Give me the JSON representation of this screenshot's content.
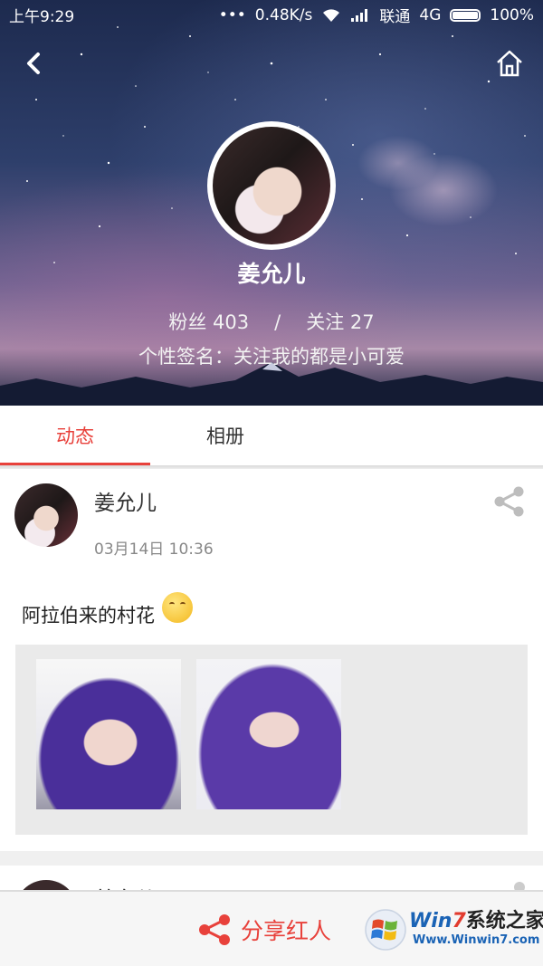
{
  "status_bar": {
    "time": "上午9:29",
    "network_speed": "0.48K/s",
    "carrier": "联通",
    "network_type": "4G",
    "battery": "100%"
  },
  "profile": {
    "name": "姜允儿",
    "fans_label": "粉丝",
    "fans_count": "403",
    "separator": "/",
    "following_label": "关注",
    "following_count": "27",
    "signature": "个性签名：关注我的都是小可爱"
  },
  "tabs": [
    {
      "label": "动态",
      "active": true
    },
    {
      "label": "相册",
      "active": false
    }
  ],
  "post": {
    "author": "姜允儿",
    "time": "03月14日 10:36",
    "text": "阿拉伯来的村花",
    "emoji": "kissing-face",
    "photo_count": 2
  },
  "next_post": {
    "author": "姜允儿"
  },
  "bottom_bar": {
    "share_label": "分享红人"
  },
  "watermark": {
    "title_win": "Win",
    "title_seven": "7",
    "title_cn": "系统之家",
    "url": "Www.Winwin7.com"
  },
  "colors": {
    "accent": "#e8413b",
    "watermark_blue": "#1a63b5"
  },
  "icons": [
    "back-icon",
    "home-icon",
    "share-icon",
    "wifi-icon",
    "signal-icon",
    "battery-icon"
  ]
}
